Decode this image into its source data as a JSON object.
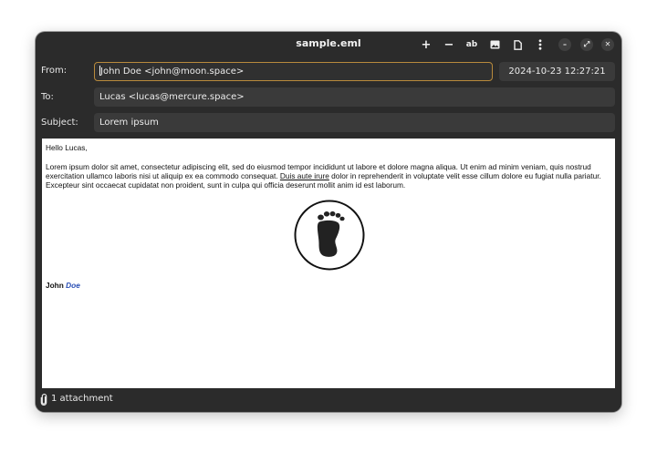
{
  "window": {
    "title": "sample.eml",
    "toolbar": {
      "add_label": "+",
      "remove_label": "−",
      "text_label": "ab"
    },
    "controls": {
      "minimize": "–",
      "maximize": "⤢",
      "close": "✕"
    }
  },
  "header": {
    "from_label": "From:",
    "from_value": "John Doe <john@moon.space>",
    "to_label": "To:",
    "to_value": "Lucas <lucas@mercure.space>",
    "subject_label": "Subject:",
    "subject_value": "Lorem ipsum",
    "date": "2024-10-23 12:27:21"
  },
  "body": {
    "greeting": "Hello Lucas,",
    "paragraph_part1": "Lorem ipsum dolor sit amet, consectetur adipiscing elit, sed do eiusmod tempor incididunt ut labore et dolore magna aliqua. Ut enim ad minim veniam, quis nostrud exercitation ullamco laboris nisi ut aliquip ex ea commodo consequat. ",
    "paragraph_link": "Duis aute irure",
    "paragraph_part2": " dolor in reprehenderit in voluptate velit esse cillum dolore eu fugiat nulla pariatur. Excepteur sint occaecat cupidatat non proident, sunt in culpa qui officia deserunt mollit anim id est laborum.",
    "signature_first": "John",
    "signature_last": "Doe",
    "signature_last_color": "#2a4fb5",
    "image_icon": "footprint-logo"
  },
  "footer": {
    "attachment_text": "1 attachment",
    "attachment_icon": "paperclip-icon"
  },
  "colors": {
    "window_bg": "#2b2b2b",
    "field_bg": "#3a3a3a",
    "focus_border": "#b88a3c"
  }
}
